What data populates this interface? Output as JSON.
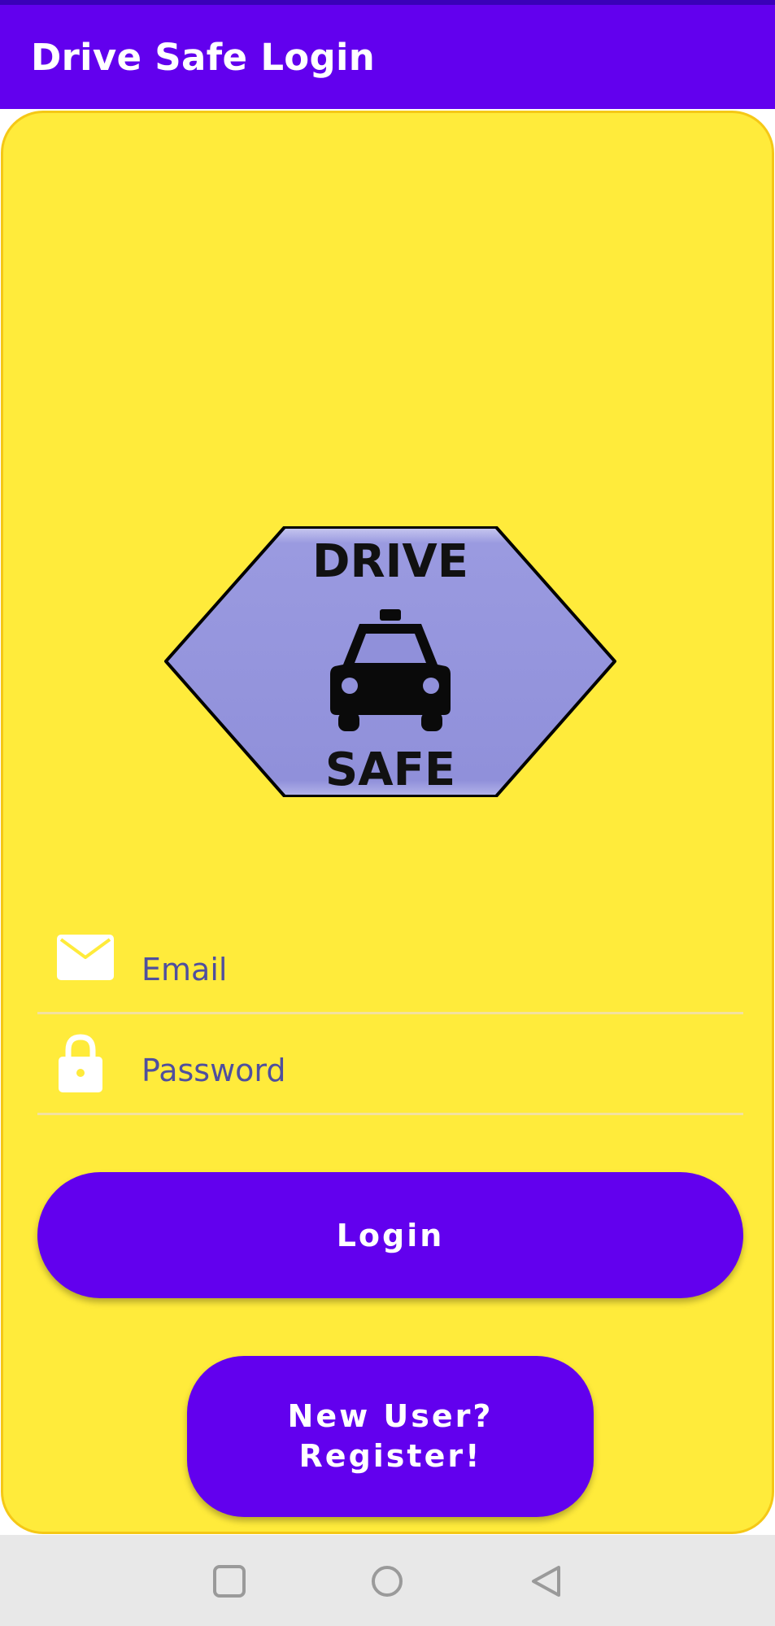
{
  "app_bar": {
    "title": "Drive Safe Login"
  },
  "logo": {
    "top_text": "DRIVE",
    "bottom_text": "SAFE",
    "icon": "car-icon",
    "fill_color": "#9090da",
    "border_color": "#000000"
  },
  "form": {
    "email": {
      "placeholder": "Email",
      "value": "",
      "icon": "email-icon"
    },
    "password": {
      "placeholder": "Password",
      "value": "",
      "icon": "lock-icon"
    }
  },
  "buttons": {
    "login_label": "Login",
    "register_label": "New User?\nRegister!"
  },
  "nav_bar": {
    "items": [
      {
        "name": "recents",
        "icon": "square-icon"
      },
      {
        "name": "home",
        "icon": "circle-icon"
      },
      {
        "name": "back",
        "icon": "back-triangle-icon"
      }
    ]
  },
  "colors": {
    "primary": "#6200ee",
    "card_background": "#ffeb3b",
    "card_border": "#f5c816",
    "nav_background": "#e8e8e8"
  }
}
